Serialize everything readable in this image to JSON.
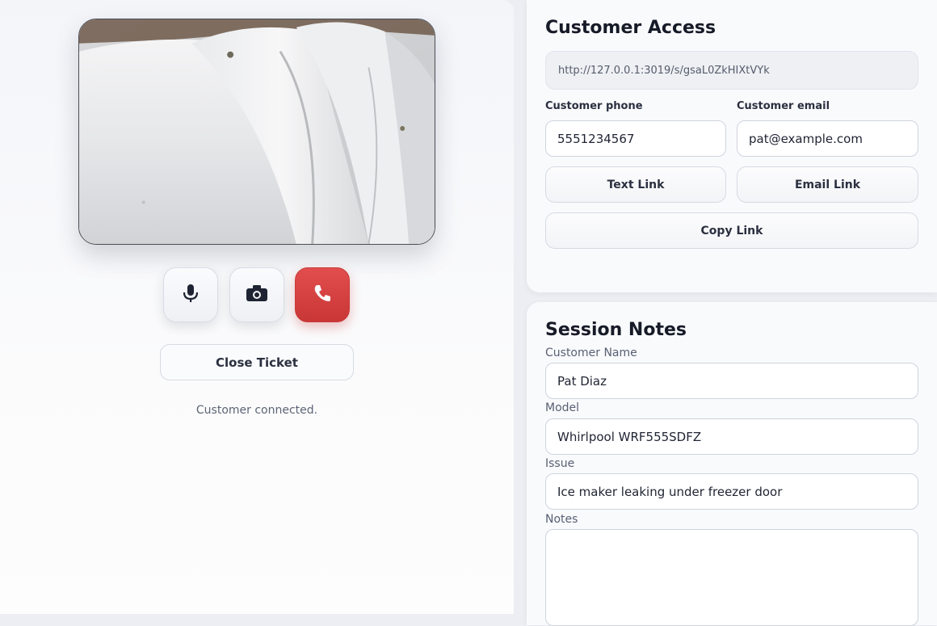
{
  "video_panel": {
    "controls": [
      {
        "name": "microphone",
        "icon": "microphone-icon"
      },
      {
        "name": "camera",
        "icon": "camera-icon"
      },
      {
        "name": "end-call",
        "icon": "phone-hangup-icon"
      }
    ],
    "close_ticket_label": "Close Ticket",
    "status_text": "Customer connected."
  },
  "customer_access": {
    "title": "Customer Access",
    "link_url": "http://127.0.0.1:3019/s/gsaL0ZkHIXtVYk",
    "phone_label": "Customer phone",
    "phone_value": "5551234567",
    "email_label": "Customer email",
    "email_value": "pat@example.com",
    "text_link_label": "Text Link",
    "email_link_label": "Email Link",
    "copy_link_label": "Copy Link"
  },
  "session_notes": {
    "title": "Session Notes",
    "customer_name_label": "Customer Name",
    "customer_name_value": "Pat Diaz",
    "model_label": "Model",
    "model_value": "Whirlpool WRF555SDFZ",
    "issue_label": "Issue",
    "issue_value": "Ice maker leaking under freezer door",
    "notes_label": "Notes",
    "notes_value": ""
  },
  "colors": {
    "end_call": "#d94343",
    "panel_bg": "#f9fafc",
    "page_bg": "#eceef3"
  }
}
